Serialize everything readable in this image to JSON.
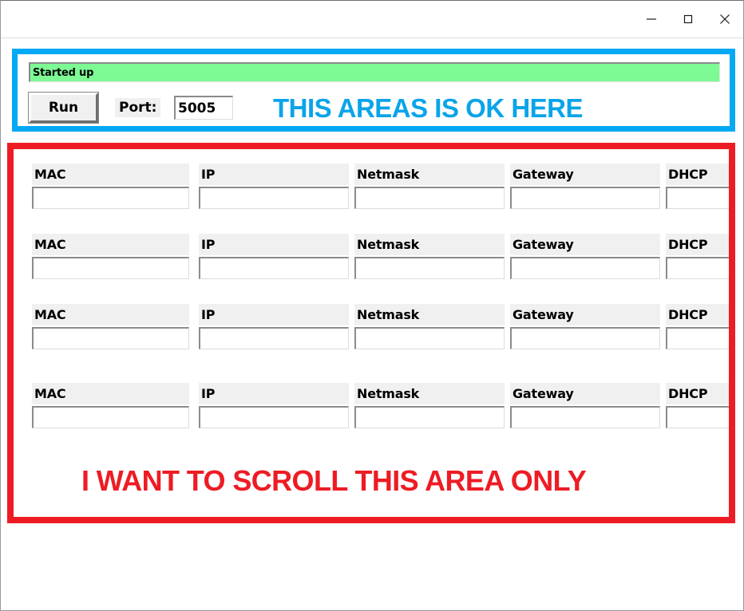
{
  "window": {
    "title": "",
    "controls": [
      {
        "name": "minimize-button",
        "icon": "minimize-icon",
        "label": "—"
      },
      {
        "name": "maximize-button",
        "icon": "maximize-icon",
        "label": "□"
      },
      {
        "name": "close-button",
        "icon": "close-icon",
        "label": "✕"
      }
    ]
  },
  "top_panel": {
    "status_text": "Started up",
    "status_background": "#7dfa94",
    "run_label": "Run",
    "port_label": "Port:",
    "port_value": "5005",
    "port_placeholder": "",
    "annotation": "THIS AREAS IS OK HERE",
    "annotation_color": "#0aa4e8",
    "border_color": "#03a9f4"
  },
  "scroll_panel": {
    "annotation": "I WANT TO SCROLL THIS AREA ONLY",
    "annotation_color": "#ed1c24",
    "border_color": "#ed1c24",
    "columns": [
      {
        "key": "mac",
        "label": "MAC"
      },
      {
        "key": "ip",
        "label": "IP"
      },
      {
        "key": "netmask",
        "label": "Netmask"
      },
      {
        "key": "gateway",
        "label": "Gateway"
      },
      {
        "key": "dhcp",
        "label": "DHCP"
      }
    ],
    "rows": [
      {
        "mac": "",
        "ip": "",
        "netmask": "",
        "gateway": "",
        "dhcp": "",
        "mac_ph": "",
        "ip_ph": "",
        "netmask_ph": "",
        "gateway_ph": "",
        "dhcp_ph": ""
      },
      {
        "mac": "",
        "ip": "",
        "netmask": "",
        "gateway": "",
        "dhcp": "",
        "mac_ph": "",
        "ip_ph": "",
        "netmask_ph": "",
        "gateway_ph": "",
        "dhcp_ph": ""
      },
      {
        "mac": "",
        "ip": "",
        "netmask": "",
        "gateway": "",
        "dhcp": "",
        "mac_ph": "",
        "ip_ph": "",
        "netmask_ph": "",
        "gateway_ph": "",
        "dhcp_ph": ""
      },
      {
        "mac": "",
        "ip": "",
        "netmask": "",
        "gateway": "",
        "dhcp": "",
        "mac_ph": "",
        "ip_ph": "",
        "netmask_ph": "",
        "gateway_ph": "",
        "dhcp_ph": ""
      }
    ]
  }
}
